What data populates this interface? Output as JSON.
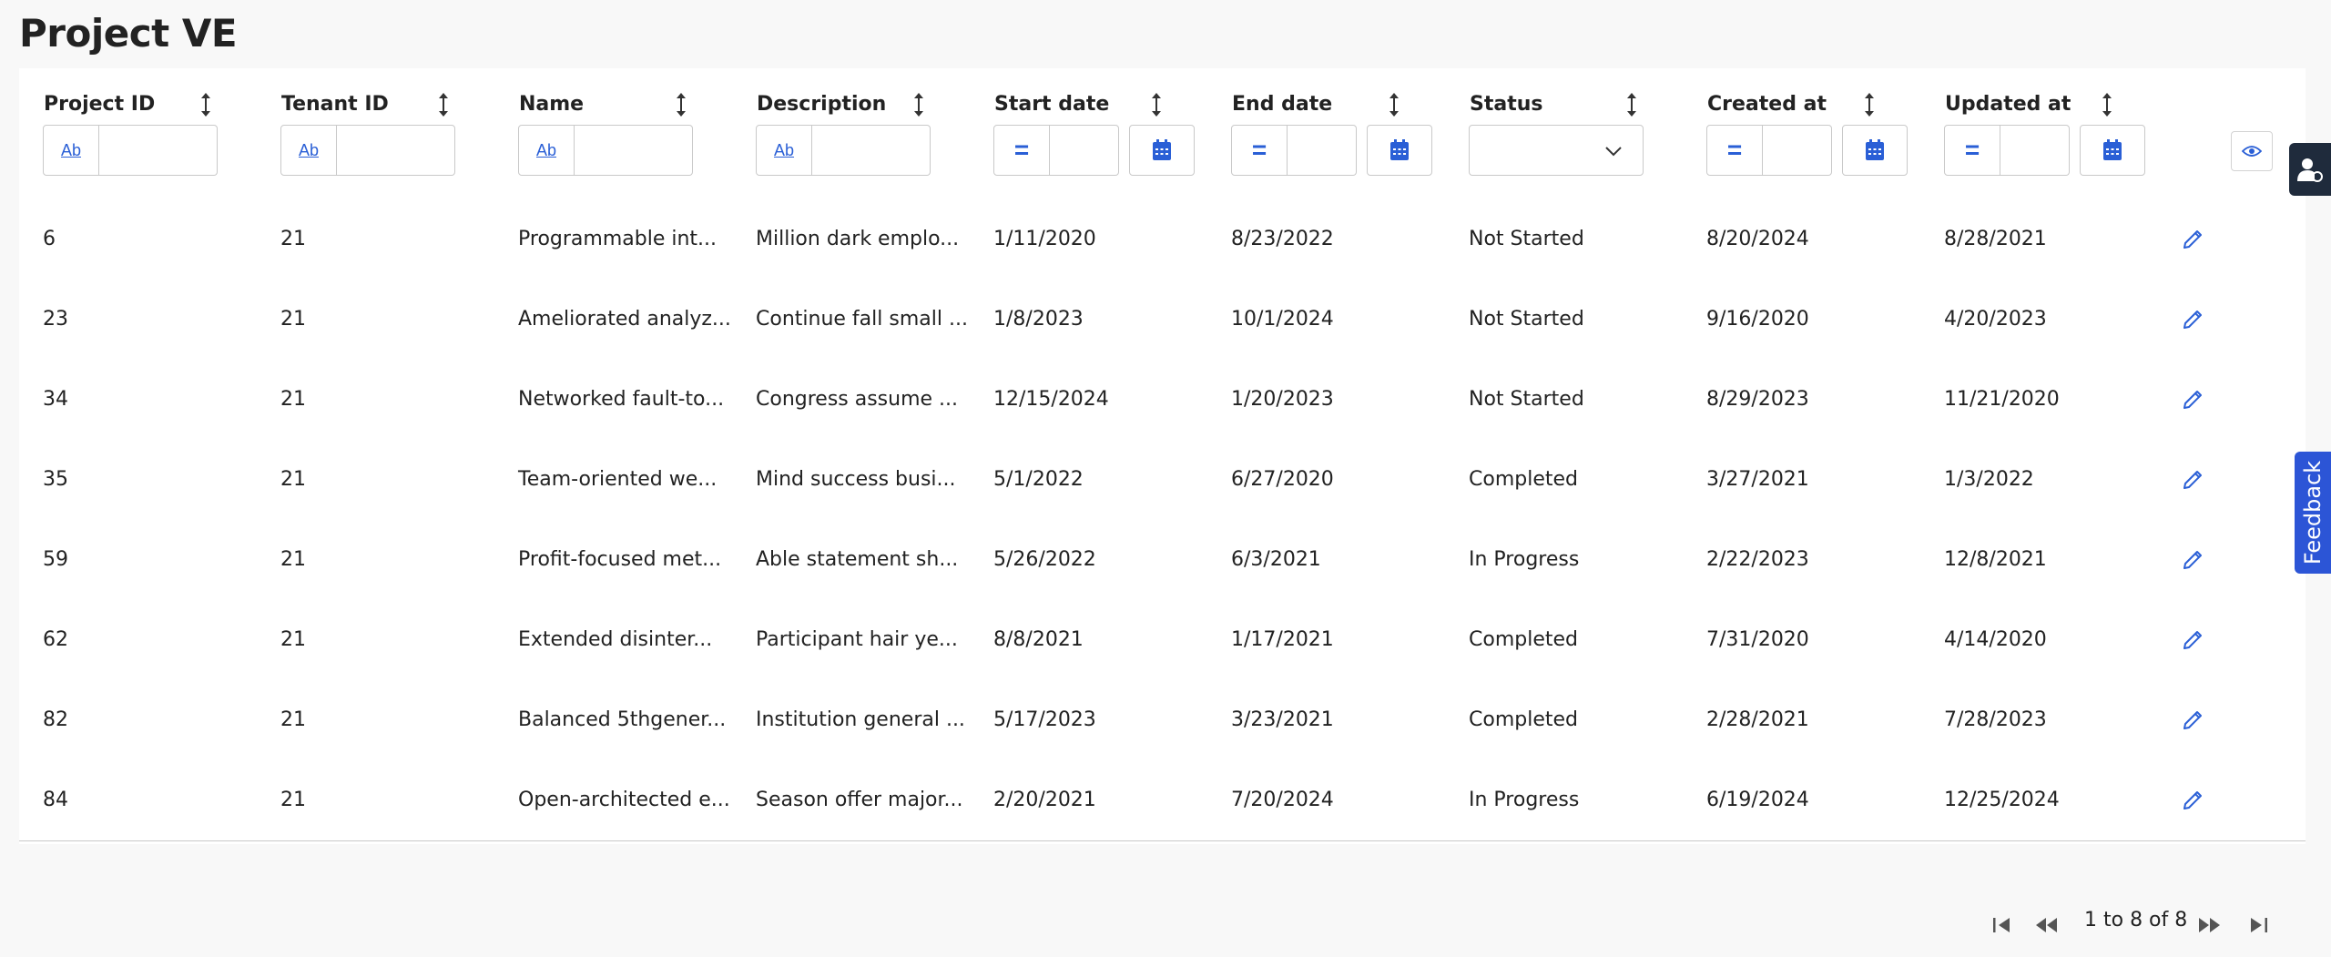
{
  "page": {
    "title": "Project VE"
  },
  "columns": {
    "project_id": "Project ID",
    "tenant_id": "Tenant ID",
    "name": "Name",
    "description": "Description",
    "start_date": "Start date",
    "end_date": "End date",
    "status": "Status",
    "created_at": "Created at",
    "updated_at": "Updated at"
  },
  "filters": {
    "text_type_label": "Ab",
    "equals_label": "=",
    "status_selected": ""
  },
  "rows": [
    {
      "project_id": "6",
      "tenant_id": "21",
      "name": "Programmable int...",
      "description": "Million dark emplo...",
      "start_date": "1/11/2020",
      "end_date": "8/23/2022",
      "status": "Not Started",
      "created_at": "8/20/2024",
      "updated_at": "8/28/2021"
    },
    {
      "project_id": "23",
      "tenant_id": "21",
      "name": "Ameliorated analyz...",
      "description": "Continue fall small ...",
      "start_date": "1/8/2023",
      "end_date": "10/1/2024",
      "status": "Not Started",
      "created_at": "9/16/2020",
      "updated_at": "4/20/2023"
    },
    {
      "project_id": "34",
      "tenant_id": "21",
      "name": "Networked fault-to...",
      "description": "Congress assume ...",
      "start_date": "12/15/2024",
      "end_date": "1/20/2023",
      "status": "Not Started",
      "created_at": "8/29/2023",
      "updated_at": "11/21/2020"
    },
    {
      "project_id": "35",
      "tenant_id": "21",
      "name": "Team-oriented we...",
      "description": "Mind success busi...",
      "start_date": "5/1/2022",
      "end_date": "6/27/2020",
      "status": "Completed",
      "created_at": "3/27/2021",
      "updated_at": "1/3/2022"
    },
    {
      "project_id": "59",
      "tenant_id": "21",
      "name": "Profit-focused met...",
      "description": "Able statement sh...",
      "start_date": "5/26/2022",
      "end_date": "6/3/2021",
      "status": "In Progress",
      "created_at": "2/22/2023",
      "updated_at": "12/8/2021"
    },
    {
      "project_id": "62",
      "tenant_id": "21",
      "name": "Extended disinter...",
      "description": "Participant hair ye...",
      "start_date": "8/8/2021",
      "end_date": "1/17/2021",
      "status": "Completed",
      "created_at": "7/31/2020",
      "updated_at": "4/14/2020"
    },
    {
      "project_id": "82",
      "tenant_id": "21",
      "name": "Balanced 5thgener...",
      "description": "Institution general ...",
      "start_date": "5/17/2023",
      "end_date": "3/23/2021",
      "status": "Completed",
      "created_at": "2/28/2021",
      "updated_at": "7/28/2023"
    },
    {
      "project_id": "84",
      "tenant_id": "21",
      "name": "Open-architected e...",
      "description": "Season offer major...",
      "start_date": "2/20/2021",
      "end_date": "7/20/2024",
      "status": "In Progress",
      "created_at": "6/19/2024",
      "updated_at": "12/25/2024"
    }
  ],
  "pagination": {
    "summary": "1 to 8 of 8"
  },
  "side_tabs": {
    "feedback_label": "Feedback"
  },
  "icons": {
    "sort": "sort-arrows-icon",
    "calendar": "calendar-icon",
    "chevron": "chevron-down-icon",
    "eye": "eye-icon",
    "edit": "pencil-icon",
    "first": "first-page-icon",
    "prev": "previous-page-icon",
    "next": "next-page-icon",
    "last": "last-page-icon",
    "user": "user-settings-icon"
  },
  "colors": {
    "accent": "#2a5fd6",
    "feedback_bg": "#2c55d6",
    "side_tab_bg": "#1f2b3c"
  }
}
